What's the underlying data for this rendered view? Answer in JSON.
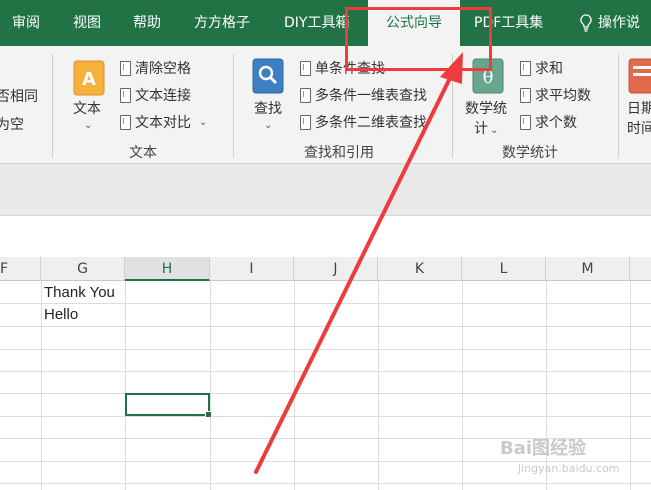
{
  "tabs": [
    {
      "label": "审阅",
      "active": false
    },
    {
      "label": "视图",
      "active": false
    },
    {
      "label": "帮助",
      "active": false
    },
    {
      "label": "方方格子",
      "active": false
    },
    {
      "label": "DIY工具箱",
      "active": false
    },
    {
      "label": "公式向导",
      "active": true
    },
    {
      "label": "PDF工具集",
      "active": false
    }
  ],
  "tell_me": "操作说",
  "ribbon": {
    "partial_left": [
      "否相同",
      "为空"
    ],
    "text_group": {
      "big_button": "文本",
      "items": [
        "清除空格",
        "文本连接",
        "文本对比"
      ],
      "label": "文本"
    },
    "lookup_group": {
      "big_button": "查找",
      "items": [
        "单条件查找",
        "多条件一维表查找",
        "多条件二维表查找"
      ],
      "label": "查找和引用"
    },
    "stats_group": {
      "big_button_line1": "数学统",
      "big_button_line2": "计",
      "items": [
        "求和",
        "求平均数",
        "求个数"
      ],
      "label": "数学统计"
    },
    "date_partial": [
      "日期",
      "时间"
    ]
  },
  "columns": [
    "F",
    "G",
    "H",
    "I",
    "J",
    "K",
    "L",
    "M"
  ],
  "selected_column": "H",
  "cells": {
    "g1": "Thank You",
    "g2": "Hello"
  },
  "watermark": {
    "main": "Bai图经验",
    "sub": "jingyan.baidu.com"
  },
  "colors": {
    "excel_green": "#217346",
    "annotation_red": "#ee3b3b"
  }
}
